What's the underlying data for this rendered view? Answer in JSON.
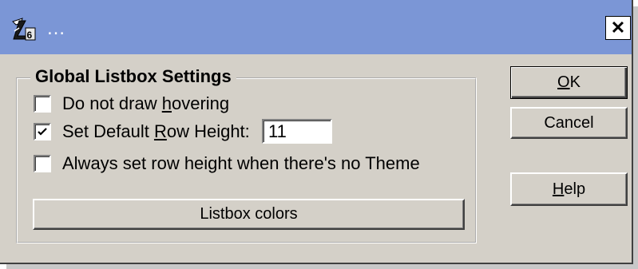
{
  "window": {
    "title": "…",
    "close_glyph": "✕",
    "app_icon": "z6-app-icon"
  },
  "group": {
    "title": "Global Listbox Settings"
  },
  "options": {
    "no_hover": {
      "pre": "Do not draw ",
      "key": "h",
      "post": "overing",
      "checked": false
    },
    "default_row": {
      "pre": "Set Default ",
      "key": "R",
      "post": "ow Height:",
      "checked": true,
      "value": "11"
    },
    "always_row": {
      "label": "Always set row height when there's no Theme",
      "checked": false
    }
  },
  "buttons": {
    "listbox_colors": "Listbox colors",
    "ok_key": "O",
    "ok_rest": "K",
    "cancel": "Cancel",
    "help_key": "H",
    "help_rest": "elp"
  },
  "colors": {
    "titlebar": "#7b96d6",
    "face": "#d4d0c8"
  }
}
